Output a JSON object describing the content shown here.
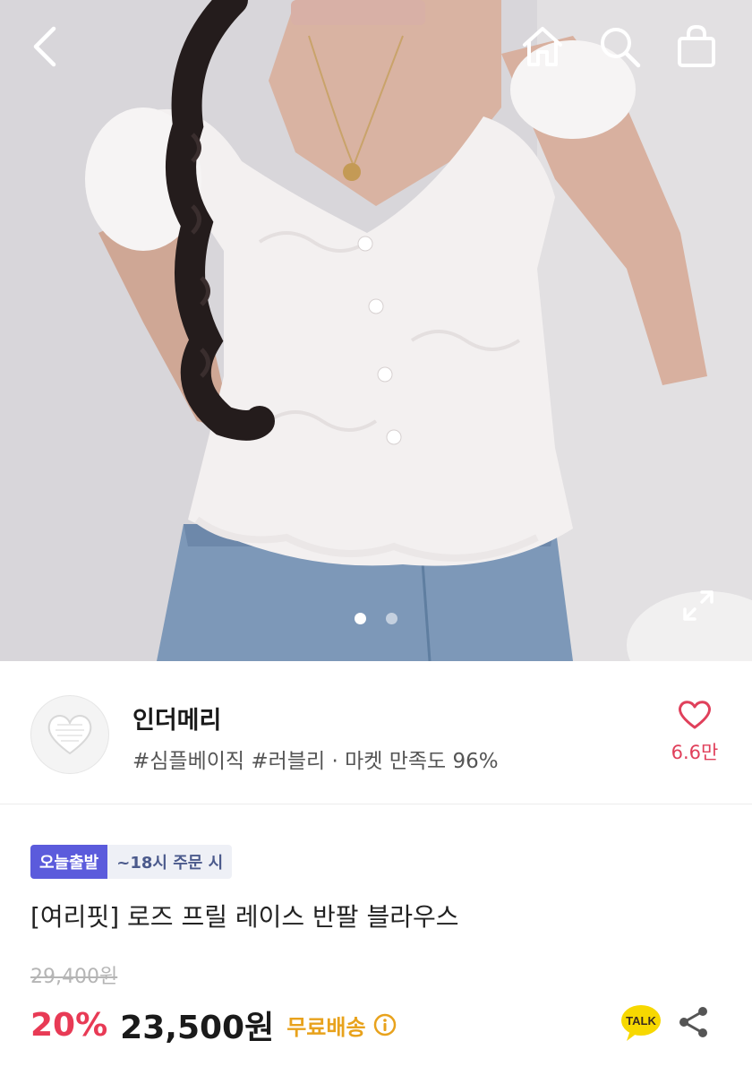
{
  "icons": {
    "back": "chevron-left-icon",
    "home": "home-icon",
    "search": "search-icon",
    "cart": "shopping-bag-icon",
    "expand": "expand-icon",
    "heart": "heart-icon",
    "info": "info-icon",
    "talk": "kakaotalk-icon",
    "share": "share-icon"
  },
  "gallery": {
    "total_images": 2,
    "active_index": 0
  },
  "shop": {
    "name": "인더메리",
    "meta": "#심플베이직 #러블리 · 마켓 만족도 96%",
    "likes": "6.6만"
  },
  "product": {
    "ship_badge": "오늘출발",
    "ship_condition": "~18시 주문 시",
    "title": "[여리핏] 로즈 프릴 레이스 반팔 블라우스",
    "original_price": "29,400원",
    "discount": "20%",
    "price": "23,500원",
    "shipping": "무료배송"
  },
  "talk_label": "TALK",
  "colors": {
    "accent_red": "#e83a55",
    "badge_blue": "#5b5bdc",
    "shipping_orange": "#e8a21c",
    "kakao_yellow": "#f7d800"
  }
}
